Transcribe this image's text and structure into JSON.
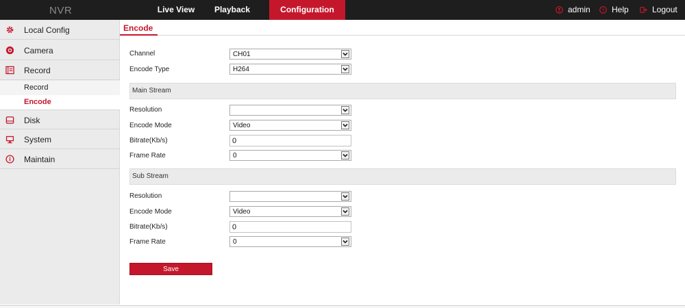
{
  "header": {
    "brand": "NVR",
    "tabs": [
      {
        "label": "Live View"
      },
      {
        "label": "Playback"
      },
      {
        "label": "Configuration"
      }
    ],
    "user": "admin",
    "help": "Help",
    "logout": "Logout",
    "accent_color": "#c5172c"
  },
  "sidebar": {
    "items": [
      {
        "label": "Local Config",
        "icon": "gear-icon"
      },
      {
        "label": "Camera",
        "icon": "camera-icon"
      },
      {
        "label": "Record",
        "icon": "record-icon"
      },
      {
        "label": "Disk",
        "icon": "disk-icon"
      },
      {
        "label": "System",
        "icon": "monitor-icon"
      },
      {
        "label": "Maintain",
        "icon": "info-icon"
      }
    ],
    "subitems": [
      {
        "label": "Record"
      },
      {
        "label": "Encode"
      }
    ]
  },
  "content": {
    "tab": "Encode",
    "channel": {
      "label": "Channel",
      "value": "CH01"
    },
    "encode_type": {
      "label": "Encode Type",
      "value": "H264"
    },
    "main_stream": {
      "title": "Main Stream",
      "resolution": {
        "label": "Resolution",
        "value": ""
      },
      "encode_mode": {
        "label": "Encode Mode",
        "value": "Video"
      },
      "bitrate": {
        "label": "Bitrate(Kb/s)",
        "value": "0"
      },
      "frame_rate": {
        "label": "Frame Rate",
        "value": "0"
      }
    },
    "sub_stream": {
      "title": "Sub Stream",
      "resolution": {
        "label": "Resolution",
        "value": ""
      },
      "encode_mode": {
        "label": "Encode Mode",
        "value": "Video"
      },
      "bitrate": {
        "label": "Bitrate(Kb/s)",
        "value": "0"
      },
      "frame_rate": {
        "label": "Frame Rate",
        "value": "0"
      }
    },
    "save_label": "Save"
  }
}
